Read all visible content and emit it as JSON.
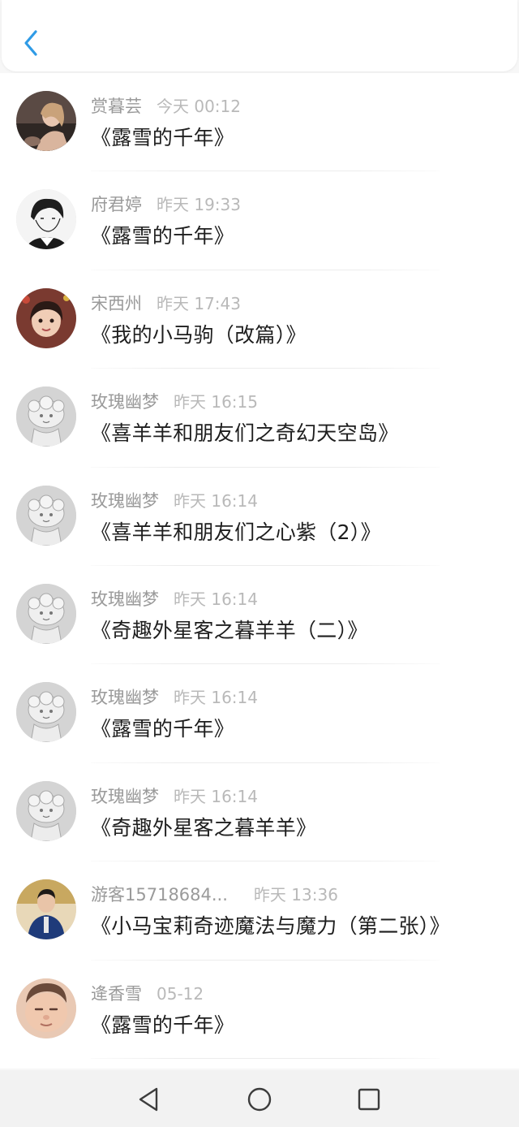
{
  "header": {
    "back_icon": "chevron-left-icon",
    "accent": "#2f9be6"
  },
  "items": [
    {
      "name": "赏暮芸",
      "time": "今天 00:12",
      "title": "《露雪的千年》",
      "avatar": "photo-girl-dark"
    },
    {
      "name": "府君婷",
      "time": "昨天 19:33",
      "title": "《露雪的千年》",
      "avatar": "anime-sketch"
    },
    {
      "name": "宋西州",
      "time": "昨天 17:43",
      "title": "《我的小马驹（改篇）》",
      "avatar": "photo-child"
    },
    {
      "name": "玫瑰幽梦",
      "time": "昨天 16:15",
      "title": "《喜羊羊和朋友们之奇幻天空岛》",
      "avatar": "cartoon-sheep"
    },
    {
      "name": "玫瑰幽梦",
      "time": "昨天 16:14",
      "title": "《喜羊羊和朋友们之心紫（2）》",
      "avatar": "cartoon-sheep"
    },
    {
      "name": "玫瑰幽梦",
      "time": "昨天 16:14",
      "title": "《奇趣外星客之暮羊羊（二）》",
      "avatar": "cartoon-sheep"
    },
    {
      "name": "玫瑰幽梦",
      "time": "昨天 16:14",
      "title": "《露雪的千年》",
      "avatar": "cartoon-sheep"
    },
    {
      "name": "玫瑰幽梦",
      "time": "昨天 16:14",
      "title": "《奇趣外星客之暮羊羊》",
      "avatar": "cartoon-sheep"
    },
    {
      "name": "游客15718684...",
      "time": "昨天 13:36",
      "title": "《小马宝莉奇迹魔法与魔力（第二张）》",
      "avatar": "photo-boy-blue"
    },
    {
      "name": "逄香雪",
      "time": "05-12",
      "title": "《露雪的千年》",
      "avatar": "photo-baby"
    }
  ],
  "navbar": {
    "back_icon": "triangle-back-icon",
    "home_icon": "circle-home-icon",
    "recents_icon": "square-recents-icon"
  }
}
